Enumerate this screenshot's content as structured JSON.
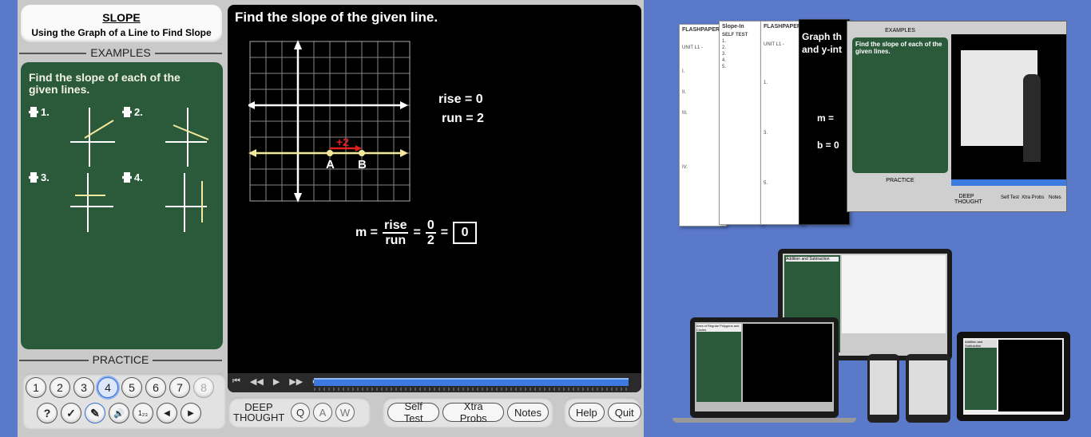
{
  "lesson": {
    "title": "SLOPE",
    "subtitle": "Using the Graph of a Line to Find Slope"
  },
  "sections": {
    "examples": "EXAMPLES",
    "practice": "PRACTICE"
  },
  "examples_board": {
    "heading": "Find the slope of each of the given lines.",
    "items": [
      {
        "label": "1."
      },
      {
        "label": "2."
      },
      {
        "label": "3."
      },
      {
        "label": "4."
      }
    ]
  },
  "practice": {
    "numbers": [
      "1",
      "2",
      "3",
      "4",
      "5",
      "6",
      "7",
      "8"
    ],
    "active": "4",
    "disabled": "8",
    "tools": [
      {
        "icon": "help-icon",
        "glyph": "?"
      },
      {
        "icon": "check-icon",
        "glyph": "✓"
      },
      {
        "icon": "notepad-icon",
        "glyph": "✎"
      },
      {
        "icon": "speaker-icon",
        "glyph": "🔊"
      },
      {
        "icon": "number-format-icon",
        "glyph": "1₂₃"
      },
      {
        "icon": "prev-icon",
        "glyph": "◀"
      },
      {
        "icon": "next-icon",
        "glyph": "▶"
      }
    ]
  },
  "problem": {
    "title": "Find the slope of the given line.",
    "rise_text": "rise = 0",
    "run_text": "run = 2",
    "run_marker": "+2",
    "point_a": "A",
    "point_b": "B",
    "m_label": "m =",
    "frac1_num": "rise",
    "frac1_den": "run",
    "frac2_num": "0",
    "frac2_den": "2",
    "equals": "=",
    "answer": "0"
  },
  "player": {
    "controls": [
      "⏮",
      "◀◀",
      "▶",
      "▶▶",
      "⏭"
    ]
  },
  "bottom_bar": {
    "deep_thought": "DEEP THOUGHT",
    "q": "Q",
    "a": "A",
    "w": "W",
    "self_test": "Self Test",
    "xtra_probs": "Xtra Probs",
    "notes": "Notes",
    "help": "Help",
    "quit": "Quit"
  },
  "promo": {
    "pages": [
      {
        "header": "FLASHPAPER",
        "lines": [
          "UNIT L1 -",
          "I.",
          "II.",
          "III.",
          "IV."
        ]
      },
      {
        "header": "Slope-In",
        "lines": [
          "SELF TEST",
          "1.",
          "2.",
          "3.",
          "4.",
          "5."
        ]
      },
      {
        "header": "FLASHPAPER",
        "lines": [
          "UNIT L1 -",
          "1.",
          "3.",
          "5."
        ]
      }
    ],
    "black_page": {
      "line1": "Graph th",
      "line2": "and y-int",
      "line3": "m =",
      "line4": "b = 0"
    },
    "screen": {
      "section": "EXAMPLES",
      "heading": "Find the slope of each of the given lines.",
      "practice": "PRACTICE",
      "deep": "DEEP THOUGHT",
      "self_test": "Self Test",
      "xtra": "Xtra Probs",
      "notes": "Notes"
    },
    "devices": {
      "monitor_title": "Addition and Subtraction",
      "laptop_title": "Area of Regular Polygons and Circles",
      "tablet_title": "Addition and Subtraction"
    }
  },
  "colors": {
    "background": "#5a79c9",
    "chrome": "#c9c9c9",
    "board": "#2a5a39",
    "line_yellow": "#f3e99c",
    "marker_red": "#e0201c"
  }
}
